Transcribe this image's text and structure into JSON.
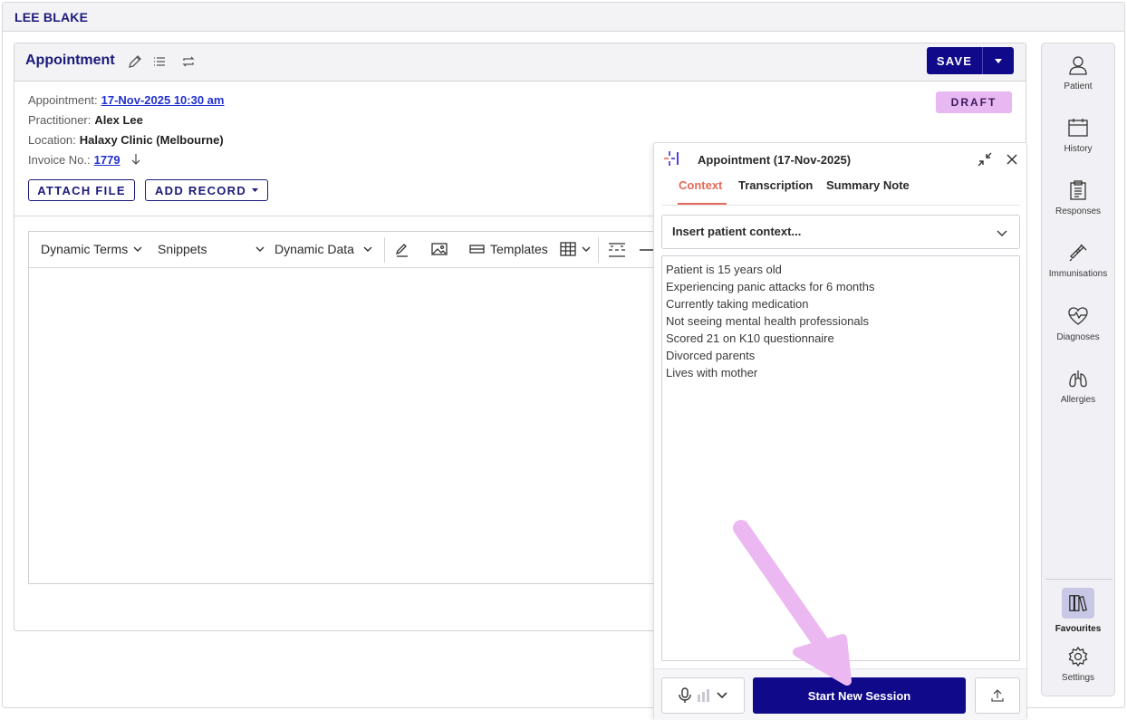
{
  "patient": {
    "name": "LEE BLAKE"
  },
  "appointment": {
    "title": "Appointment",
    "save_label": "SAVE",
    "status": "DRAFT",
    "details": {
      "appointment_label": "Appointment:",
      "appointment_value": "17-Nov-2025 10:30 am",
      "practitioner_label": "Practitioner:",
      "practitioner_value": "Alex Lee",
      "location_label": "Location:",
      "location_value": "Halaxy Clinic (Melbourne)",
      "invoice_label": "Invoice No.:",
      "invoice_value": "1779"
    },
    "attach_file_label": "ATTACH FILE",
    "add_record_label": "ADD RECORD"
  },
  "editor_toolbar": {
    "dynamic_terms": "Dynamic Terms",
    "snippets": "Snippets",
    "dynamic_data": "Dynamic Data",
    "templates": "Templates"
  },
  "ai_panel": {
    "title": "Appointment (17-Nov-2025)",
    "tabs": [
      {
        "label": "Context",
        "active": true
      },
      {
        "label": "Transcription",
        "active": false
      },
      {
        "label": "Summary Note",
        "active": false
      }
    ],
    "context_select": "Insert patient context...",
    "context_lines": [
      "Patient is 15 years old",
      "Experiencing panic attacks for 6 months",
      "Currently taking medication",
      "Not seeing mental health professionals",
      "Scored 21 on K10 questionnaire",
      "Divorced parents",
      "Lives with mother"
    ],
    "start_button": "Start New Session"
  },
  "side_rail": {
    "items": [
      {
        "label": "Patient",
        "icon": "person-icon"
      },
      {
        "label": "History",
        "icon": "calendar-icon"
      },
      {
        "label": "Responses",
        "icon": "clipboard-icon"
      },
      {
        "label": "Immunisations",
        "icon": "syringe-icon"
      },
      {
        "label": "Diagnoses",
        "icon": "heart-pulse-icon"
      },
      {
        "label": "Allergies",
        "icon": "lungs-icon"
      }
    ],
    "favourites": "Favourites",
    "settings": "Settings"
  },
  "colors": {
    "primary": "#10098a",
    "heading": "#1c1a7a",
    "draft_badge": "#e8b8f3",
    "active_tab": "#e36a58",
    "annotation_arrow": "#ecb8f2"
  }
}
